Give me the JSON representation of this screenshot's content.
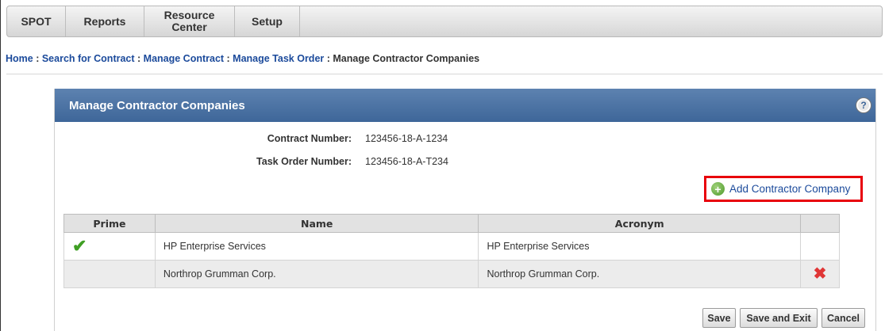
{
  "nav": {
    "spot": "SPOT",
    "reports": "Reports",
    "resource_center": "Resource\nCenter",
    "setup": "Setup"
  },
  "breadcrumb": {
    "home": "Home",
    "search": "Search for Contract",
    "manage_contract": "Manage Contract",
    "manage_task_order": "Manage Task Order",
    "current": "Manage Contractor Companies",
    "separator": " : "
  },
  "panel": {
    "title": "Manage Contractor Companies",
    "help_icon": "question-mark-icon"
  },
  "fields": {
    "contract_number_label": "Contract Number:",
    "contract_number_value": "123456-18-A-1234",
    "task_order_label": "Task Order Number:",
    "task_order_value": "123456-18-A-T234"
  },
  "add_button": {
    "label": "Add Contractor Company",
    "icon": "plus-circle-icon"
  },
  "table": {
    "headers": [
      "Prime",
      "Name",
      "Acronym",
      ""
    ],
    "rows": [
      {
        "prime": true,
        "name": "HP Enterprise Services",
        "acronym": "HP Enterprise Services",
        "deletable": false
      },
      {
        "prime": false,
        "name": "Northrop Grumman Corp.",
        "acronym": "Northrop Grumman Corp.",
        "deletable": true
      }
    ]
  },
  "buttons": {
    "save": "Save",
    "save_exit": "Save and Exit",
    "cancel": "Cancel"
  },
  "colors": {
    "header_blue": "#3e6699",
    "link_blue": "#1b4a9b",
    "highlight_red": "#e8000b",
    "check_green": "#3f9f24",
    "delete_red": "#e03636"
  }
}
